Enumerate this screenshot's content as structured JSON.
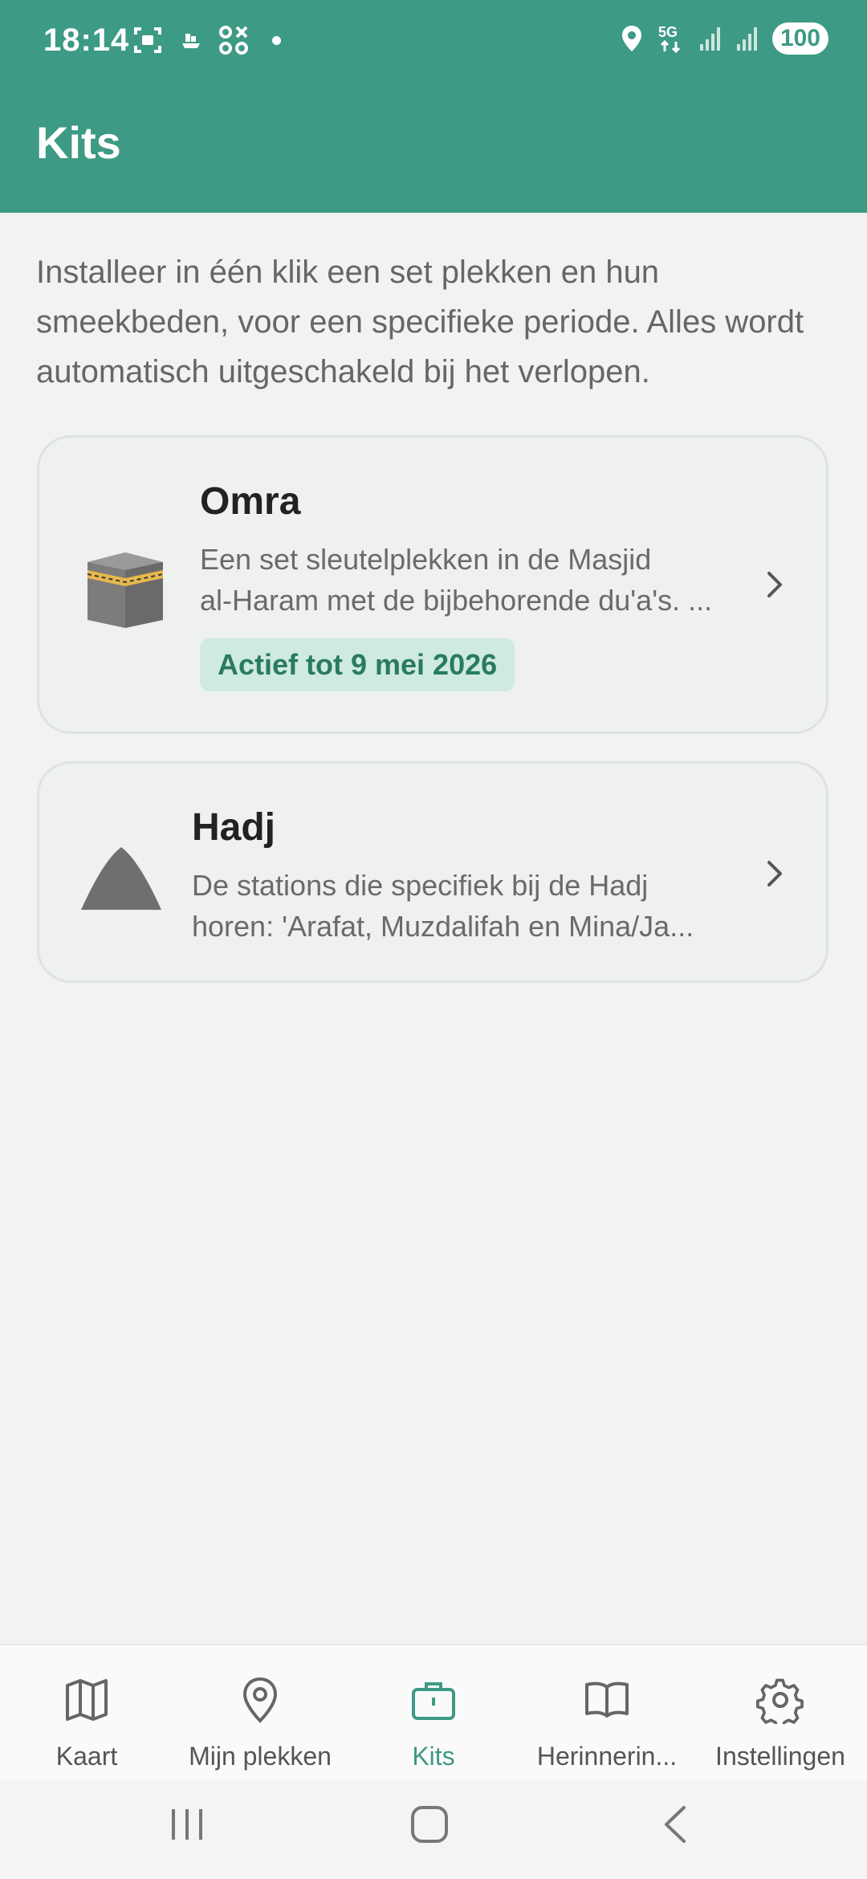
{
  "status_bar": {
    "time": "18:14",
    "battery": "100",
    "network": "5G"
  },
  "app_bar": {
    "title": "Kits"
  },
  "intro_text": "Installeer in één klik een set plekken en hun smeekbeden, voor een specifieke periode. Alles wordt automatisch uitgeschakeld bij het verlopen.",
  "kits": [
    {
      "title": "Omra",
      "desc_line1": "Een set sleutelplekken in de Masjid",
      "desc_line2": "al-Haram met de bijbehorende du'a's. ...",
      "badge": "Actief tot 9 mei 2026",
      "icon": "kaaba-icon"
    },
    {
      "title": "Hadj",
      "desc_line1": "De stations die specifiek bij de Hadj",
      "desc_line2": "horen: 'Arafat, Muzdalifah en Mina/Ja...",
      "icon": "mountain-icon"
    }
  ],
  "bottom_nav": {
    "items": [
      {
        "label": "Kaart",
        "icon": "map-icon"
      },
      {
        "label": "Mijn plekken",
        "icon": "pin-icon"
      },
      {
        "label": "Kits",
        "icon": "briefcase-icon",
        "active": true
      },
      {
        "label": "Herinnerin...",
        "icon": "book-icon"
      },
      {
        "label": "Instellingen",
        "icon": "gear-icon"
      }
    ]
  },
  "colors": {
    "primary": "#3d9a84",
    "badge_bg": "#cfeadf",
    "badge_text": "#2a7a63"
  }
}
